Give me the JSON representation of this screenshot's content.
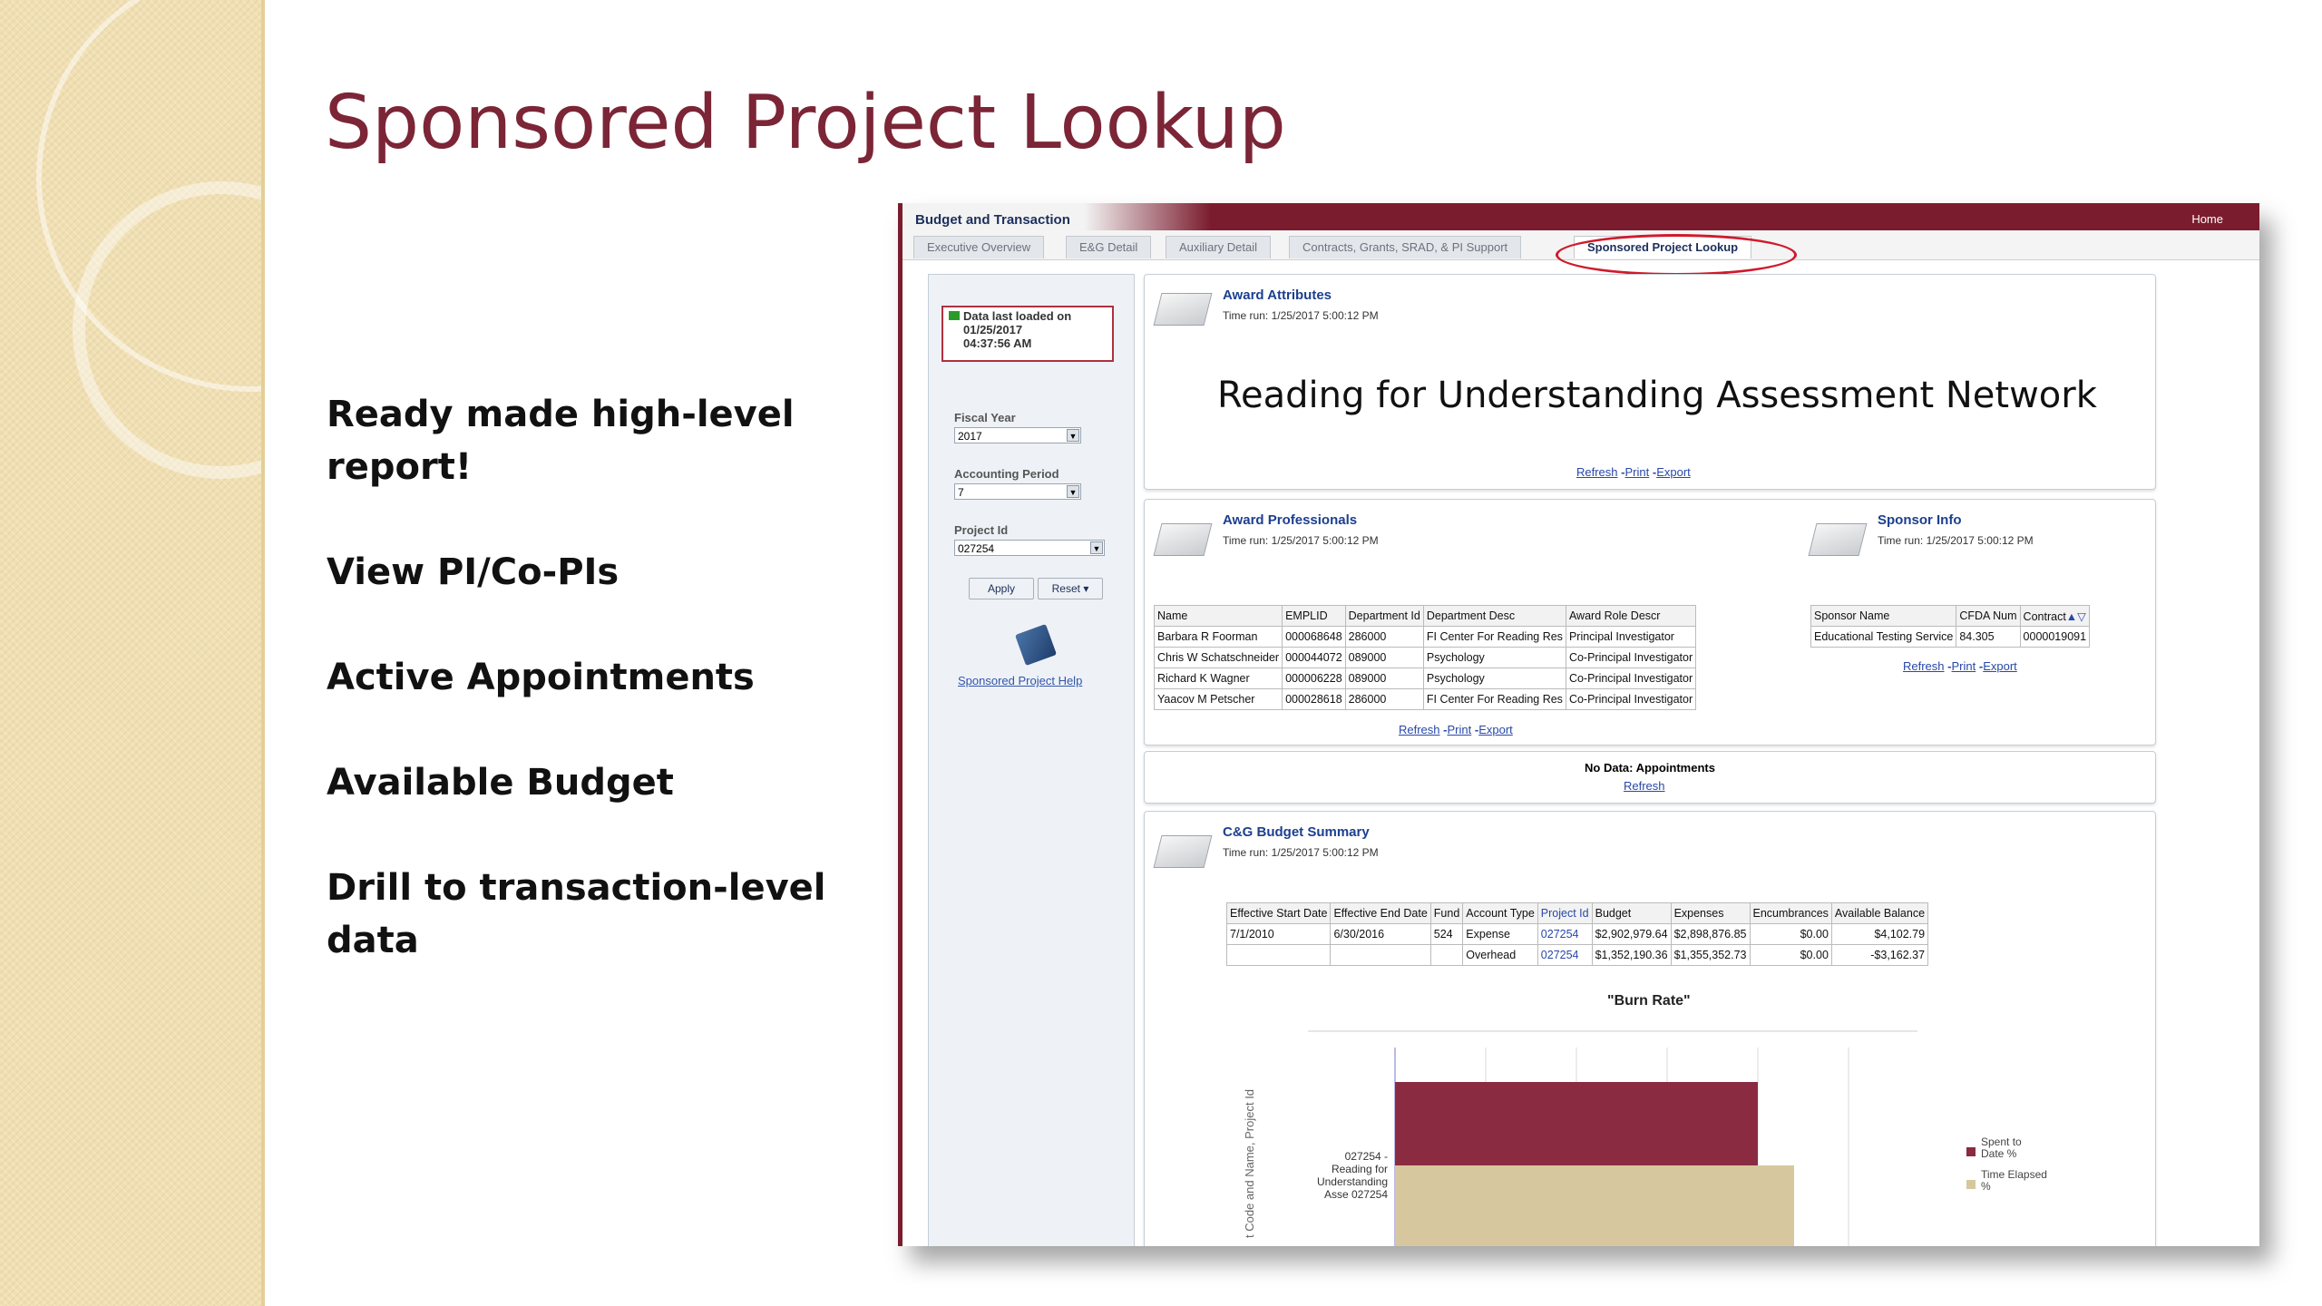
{
  "slide": {
    "title": "Sponsored Project Lookup",
    "bullets": [
      "Ready made high-level report!",
      "View PI/Co-PIs",
      "Active Appointments",
      "Available Budget",
      "Drill to transaction-level data"
    ]
  },
  "app": {
    "name": "Budget and Transaction",
    "home": "Home",
    "tabs": [
      "Executive Overview",
      "E&G Detail",
      "Auxiliary Detail",
      "Contracts, Grants, SRAD, & PI Support",
      "Sponsored Project Lookup"
    ]
  },
  "prompts": {
    "last_loaded_line1": "Data last loaded on",
    "last_loaded_line2": "01/25/2017",
    "last_loaded_line3": "04:37:56 AM",
    "fiscal_year_label": "Fiscal Year",
    "fiscal_year_value": "2017",
    "accounting_period_label": "Accounting Period",
    "accounting_period_value": "7",
    "project_id_label": "Project Id",
    "project_id_value": "027254",
    "apply": "Apply",
    "reset": "Reset ▾",
    "help": "Sponsored Project Help"
  },
  "links": {
    "refresh": "Refresh",
    "print": "Print",
    "export": "Export",
    "sep": "-"
  },
  "award_attributes": {
    "title": "Award Attributes",
    "time": "Time run: 1/25/2017 5:00:12 PM",
    "award_name": "Reading for Understanding Assessment Network"
  },
  "award_professionals": {
    "title": "Award Professionals",
    "time": "Time run: 1/25/2017 5:00:12 PM",
    "headers": [
      "Name",
      "EMPLID",
      "Department Id",
      "Department Desc",
      "Award Role Descr"
    ],
    "rows": [
      [
        "Barbara R Foorman",
        "000068648",
        "286000",
        "FI Center For Reading Res",
        "Principal Investigator"
      ],
      [
        "Chris W Schatschneider",
        "000044072",
        "089000",
        "Psychology",
        "Co-Principal Investigator"
      ],
      [
        "Richard K Wagner",
        "000006228",
        "089000",
        "Psychology",
        "Co-Principal Investigator"
      ],
      [
        "Yaacov M Petscher",
        "000028618",
        "286000",
        "FI Center For Reading Res",
        "Co-Principal Investigator"
      ]
    ]
  },
  "sponsor_info": {
    "title": "Sponsor Info",
    "time": "Time run: 1/25/2017 5:00:12 PM",
    "headers": [
      "Sponsor Name",
      "CFDA Num",
      "Contract"
    ],
    "rows": [
      [
        "Educational Testing Service",
        "84.305",
        "0000019091"
      ]
    ]
  },
  "appointments": {
    "title": "No Data: Appointments",
    "refresh": "Refresh"
  },
  "budget_summary": {
    "title": "C&G Budget Summary",
    "time": "Time run: 1/25/2017 5:00:12 PM",
    "headers": [
      "Effective Start Date",
      "Effective End Date",
      "Fund",
      "Account Type",
      "Project Id",
      "Budget",
      "Expenses",
      "Encumbrances",
      "Available Balance"
    ],
    "rows": [
      [
        "7/1/2010",
        "6/30/2016",
        "524",
        "Expense",
        "027254",
        "$2,902,979.64",
        "$2,898,876.85",
        "$0.00",
        "$4,102.79"
      ],
      [
        "",
        "",
        "",
        "Overhead",
        "027254",
        "$1,352,190.36",
        "$1,355,352.73",
        "$0.00",
        "-$3,162.37"
      ]
    ]
  },
  "chart_data": {
    "type": "bar",
    "orientation": "horizontal",
    "title": "\"Burn Rate\"",
    "ylabel": "t Code and Name, Project Id",
    "categories": [
      "027254 - Reading for Understanding Asse 027254"
    ],
    "series": [
      {
        "name": "Spent to Date %",
        "values": [
          100
        ],
        "color": "#8b2b42"
      },
      {
        "name": "Time Elapsed %",
        "values": [
          110
        ],
        "color": "#d6c79e"
      }
    ],
    "xlim": [
      0,
      125
    ],
    "grid": true,
    "legend": "right"
  }
}
